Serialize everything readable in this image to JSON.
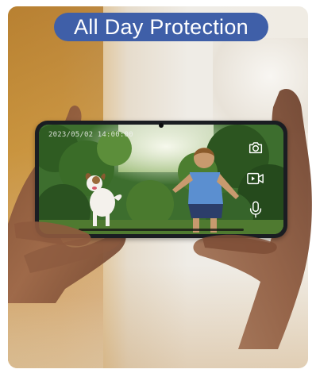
{
  "banner": {
    "title": "All Day Protection"
  },
  "camera_view": {
    "timestamp": "2023/05/02  14:00:00"
  },
  "controls": [
    {
      "icon": "camera-icon",
      "action": "snapshot"
    },
    {
      "icon": "video-record-icon",
      "action": "record"
    },
    {
      "icon": "microphone-icon",
      "action": "talk"
    }
  ],
  "colors": {
    "banner_bg": "#3f5fa8",
    "banner_text": "#ffffff",
    "icon_stroke": "#ffffff",
    "phone_frame": "#1a1d22"
  }
}
